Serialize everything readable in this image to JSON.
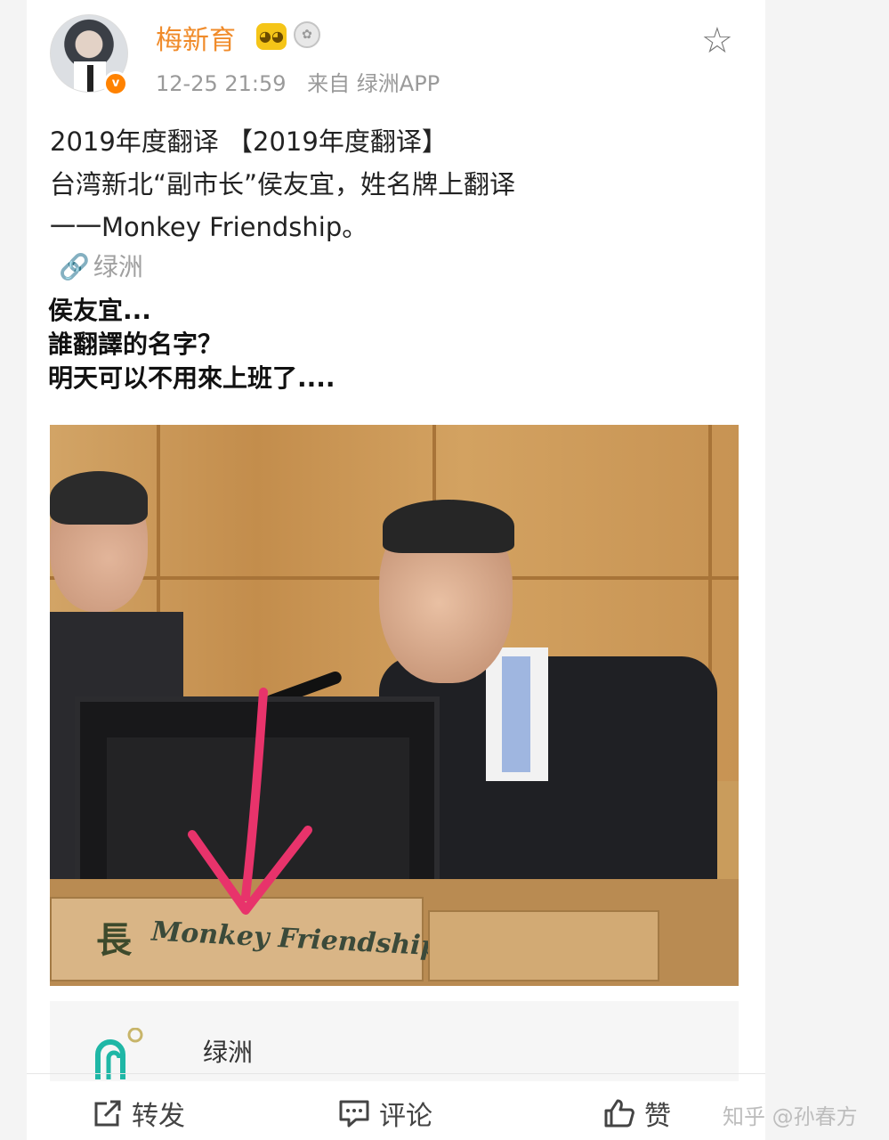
{
  "post": {
    "username": "梅新育",
    "timestamp": "12-25 21:59",
    "source": "来自 绿洲APP",
    "text_lines": [
      "2019年度翻译 【2019年度翻译】",
      "台湾新北“副市长”侯友宜，姓名牌上翻译",
      "一一Monkey Friendship。"
    ],
    "link_label": "绿洲",
    "caption_lines": [
      "侯友宜...",
      "誰翻譯的名字？",
      "明天可以不用來上班了...."
    ],
    "image": {
      "nameplate_char": "長",
      "nameplate_text": "Monkey Friendship"
    }
  },
  "oasis_card": {
    "label": "绿洲"
  },
  "actions": {
    "repost": "转发",
    "comment": "评论",
    "like": "赞"
  },
  "watermark": "知乎 @孙春方",
  "colors": {
    "username": "#f08b2a",
    "arrow": "#e8336b",
    "verified_badge": "#ff8200"
  }
}
